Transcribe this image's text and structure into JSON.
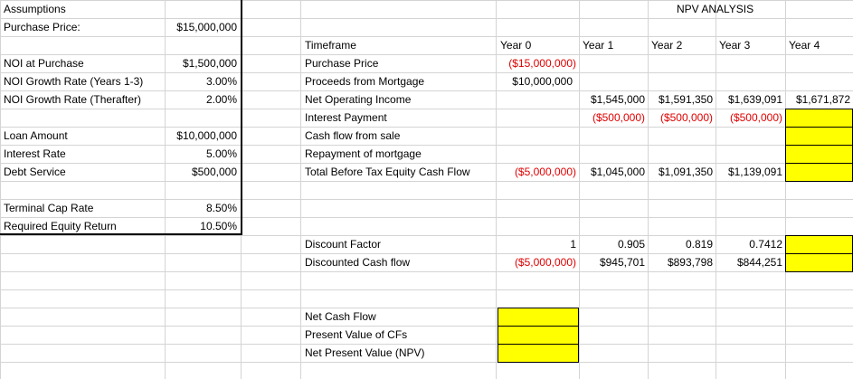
{
  "assumptions": {
    "header": "Assumptions",
    "purchase_price_label": "Purchase Price:",
    "purchase_price": "$15,000,000",
    "noi_label": "NOI at Purchase",
    "noi": "$1,500,000",
    "growth1_label": "NOI Growth Rate (Years 1-3)",
    "growth1": "3.00%",
    "growth2_label": "NOI Growth Rate (Therafter)",
    "growth2": "2.00%",
    "loan_label": "Loan Amount",
    "loan": "$10,000,000",
    "interest_label": "Interest Rate",
    "interest": "5.00%",
    "debt_label": "Debt Service",
    "debt": "$500,000",
    "cap_label": "Terminal Cap Rate",
    "cap": "8.50%",
    "equity_label": "Required Equity Return",
    "equity": "10.50%"
  },
  "npv": {
    "title": "NPV ANALYSIS",
    "labels": {
      "timeframe": "Timeframe",
      "purchase": "Purchase Price",
      "mortgage": "Proceeds from Mortgage",
      "noi": "Net Operating Income",
      "interest": "Interest Payment",
      "cashsale": "Cash flow from sale",
      "repay": "Repayment of mortgage",
      "total": "Total Before Tax Equity Cash Flow",
      "discount": "Discount Factor",
      "dcf": "Discounted Cash flow",
      "net": "Net Cash Flow",
      "pv": "Present Value of CFs",
      "npv": "Net Present Value (NPV)"
    },
    "years": [
      "Year 0",
      "Year 1",
      "Year 2",
      "Year 3",
      "Year 4"
    ],
    "purchase_y0": "($15,000,000)",
    "mortgage_y0": "$10,000,000",
    "noi": [
      "$1,545,000",
      "$1,591,350",
      "$1,639,091",
      "$1,671,872"
    ],
    "interest": [
      "($500,000)",
      "($500,000)",
      "($500,000)"
    ],
    "total": [
      "($5,000,000)",
      "$1,045,000",
      "$1,091,350",
      "$1,139,091"
    ],
    "discount": [
      "1",
      "0.905",
      "0.819",
      "0.7412"
    ],
    "dcf": [
      "($5,000,000)",
      "$945,701",
      "$893,798",
      "$844,251"
    ]
  },
  "colors": {
    "highlight": "#ffff00",
    "negative": "#e00000",
    "grid": "#d4d4d4"
  }
}
